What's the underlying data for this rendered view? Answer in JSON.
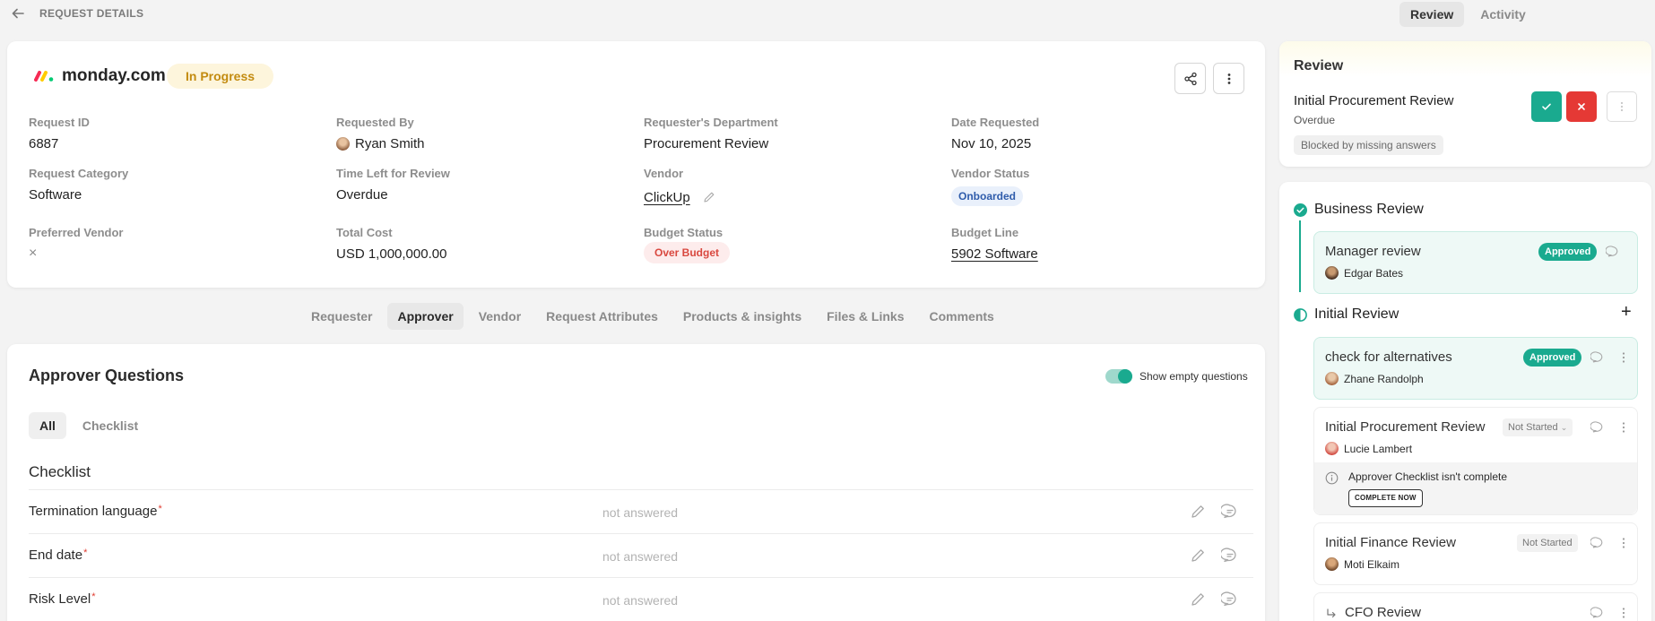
{
  "header": {
    "page_label": "REQUEST DETAILS",
    "right_tabs": [
      "Review",
      "Activity"
    ]
  },
  "request": {
    "vendor_name": "monday.com",
    "status": "In Progress",
    "fields": {
      "request_id": {
        "label": "Request ID",
        "value": "6887"
      },
      "requested_by": {
        "label": "Requested By",
        "value": "Ryan Smith"
      },
      "department": {
        "label": "Requester's Department",
        "value": "Procurement Review"
      },
      "date_requested": {
        "label": "Date Requested",
        "value": "Nov 10, 2025"
      },
      "category": {
        "label": "Request Category",
        "value": "Software"
      },
      "time_left": {
        "label": "Time Left for Review",
        "value": "Overdue"
      },
      "vendor": {
        "label": "Vendor",
        "value": "ClickUp"
      },
      "vendor_status": {
        "label": "Vendor Status",
        "value": "Onboarded"
      },
      "preferred_vendor": {
        "label": "Preferred Vendor",
        "value": "×"
      },
      "total_cost": {
        "label": "Total Cost",
        "value": "USD 1,000,000.00"
      },
      "budget_status": {
        "label": "Budget Status",
        "value": "Over Budget"
      },
      "budget_line": {
        "label": "Budget Line",
        "value": "5902 Software"
      }
    }
  },
  "section_tabs": [
    "Requester",
    "Approver",
    "Vendor",
    "Request Attributes",
    "Products & insights",
    "Files & Links",
    "Comments"
  ],
  "questions": {
    "title": "Approver Questions",
    "toggle_label": "Show empty questions",
    "subtabs": [
      "All",
      "Checklist"
    ],
    "section_title": "Checklist",
    "rows": [
      {
        "label": "Termination language",
        "required": "*",
        "answer": "not answered"
      },
      {
        "label": "End date",
        "required": "*",
        "answer": "not answered"
      },
      {
        "label": "Risk Level",
        "required": "*",
        "answer": "not answered"
      }
    ]
  },
  "review": {
    "title": "Review",
    "step": "Initial Procurement Review",
    "step_status": "Overdue",
    "blocked": "Blocked by missing answers"
  },
  "workflow": {
    "stages": [
      {
        "name": "Business Review"
      },
      {
        "name": "Initial Review",
        "add": "+"
      }
    ],
    "tasks": [
      {
        "title": "Manager review",
        "person": "Edgar Bates",
        "status": "Approved"
      },
      {
        "title": "check for alternatives",
        "person": "Zhane Randolph",
        "status": "Approved"
      },
      {
        "title": "Initial Procurement Review",
        "person": "Lucie Lambert",
        "status": "Not Started",
        "warning": "Approver Checklist isn't complete",
        "action": "COMPLETE NOW"
      },
      {
        "title": "Initial Finance Review",
        "person": "Moti Elkaim",
        "status": "Not Started"
      },
      {
        "title": "CFO Review"
      }
    ]
  },
  "colors": {
    "accent": "#1aaa8f",
    "danger": "#e53935",
    "warning_bg": "#fdf5dc",
    "warning_text": "#c38b10"
  }
}
